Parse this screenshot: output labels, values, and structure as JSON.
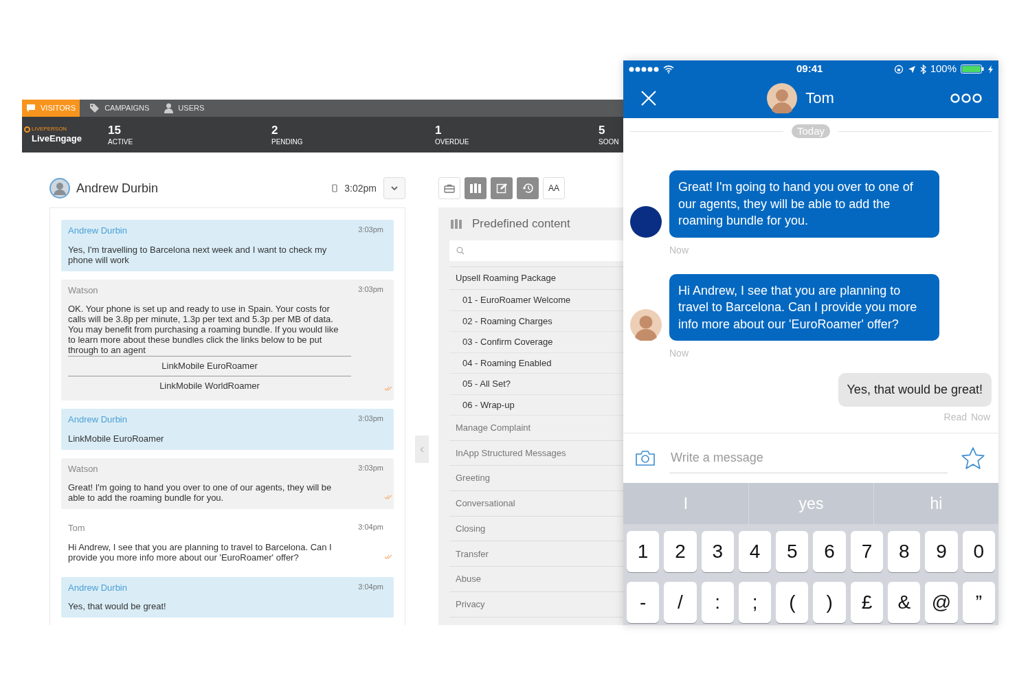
{
  "nav": {
    "tabs": [
      {
        "label": "VISITORS",
        "kind": "chat",
        "selected": true
      },
      {
        "label": "CAMPAIGNS",
        "kind": "tag",
        "selected": false
      },
      {
        "label": "USERS",
        "kind": "user",
        "selected": false
      }
    ]
  },
  "brand": {
    "tagline": "LIVEPERSON",
    "name": "LiveEngage"
  },
  "stats": [
    {
      "value": "15",
      "label": "ACTIVE"
    },
    {
      "value": "2",
      "label": "PENDING"
    },
    {
      "value": "1",
      "label": "OVERDUE"
    },
    {
      "value": "5",
      "label": "SOON"
    }
  ],
  "conversation": {
    "visitor": "Andrew Durbin",
    "time": "3:02pm",
    "messages": [
      {
        "kind": "visitor",
        "sender": "Andrew Durbin",
        "time": "3:03pm",
        "text": "Yes, I'm travelling to Barcelona next week and I want to check my phone will work",
        "read": false
      },
      {
        "kind": "bot",
        "sender": "Watson",
        "time": "3:03pm",
        "text": "OK. Your phone is set up and ready to use in Spain. Your costs for calls will be 3.8p per minute, 1.3p per text and 5.3p per MB of data. You may benefit from purchasing a roaming bundle. If you would like to learn more about these bundles click the links below to be put through to an agent",
        "links": [
          "LinkMobile EuroRoamer",
          "LinkMobile WorldRoamer"
        ],
        "read": true
      },
      {
        "kind": "visitor",
        "sender": "Andrew Durbin",
        "time": "3:03pm",
        "text": "LinkMobile EuroRoamer",
        "read": false
      },
      {
        "kind": "bot",
        "sender": "Watson",
        "time": "3:03pm",
        "text": "Great! I'm going to hand you over to one of our agents, they will be able to add the roaming bundle for you.",
        "read": true
      },
      {
        "kind": "agent",
        "sender": "Tom",
        "time": "3:04pm",
        "text": "Hi Andrew, I see that you are planning to travel to Barcelona. Can I provide you more info more about our 'EuroRoamer' offer?",
        "read": true
      },
      {
        "kind": "visitor",
        "sender": "Andrew Durbin",
        "time": "3:04pm",
        "text": "Yes, that would be great!",
        "read": false
      }
    ]
  },
  "tools": {
    "buttons": [
      {
        "kind": "briefcase",
        "selected": false
      },
      {
        "kind": "library",
        "selected": true
      },
      {
        "kind": "edit",
        "selected": true
      },
      {
        "kind": "history",
        "selected": true
      },
      {
        "kind": "text",
        "label": "AA",
        "selected": false
      }
    ]
  },
  "predefined": {
    "title": "Predefined content",
    "groups": [
      {
        "label": "Upsell Roaming Package",
        "expanded": true,
        "children": [
          {
            "label": "01 - EuroRoamer Welcome"
          },
          {
            "label": "02 - Roaming Charges"
          },
          {
            "label": "03 - Confirm Coverage"
          },
          {
            "label": "04 - Roaming Enabled"
          },
          {
            "label": "05 - All Set?"
          },
          {
            "label": "06 - Wrap-up"
          }
        ]
      },
      {
        "label": "Manage Complaint",
        "expanded": false
      },
      {
        "label": "InApp Structured Messages",
        "expanded": false
      },
      {
        "label": "Greeting",
        "expanded": false
      },
      {
        "label": "Conversational",
        "expanded": false
      },
      {
        "label": "Closing",
        "expanded": false
      },
      {
        "label": "Transfer",
        "expanded": false
      },
      {
        "label": "Abuse",
        "expanded": false
      },
      {
        "label": "Privacy",
        "expanded": false
      }
    ]
  },
  "phone": {
    "status_bar": {
      "time": "09:41",
      "battery": "100%"
    },
    "header": {
      "name": "Tom"
    },
    "divider": "Today",
    "messages": [
      {
        "kind": "bot",
        "text": "Great! I'm going to hand you over to one of our agents, they will be able to add the roaming bundle for you.",
        "time": "Now"
      },
      {
        "kind": "agent",
        "text": "Hi Andrew, I see that you are planning to travel to Barcelona. Can I provide you more info more about our 'EuroRoamer' offer?",
        "time": "Now"
      },
      {
        "kind": "visitor",
        "text": "Yes, that would be great!",
        "status": "Read",
        "time": "Now"
      }
    ],
    "input": {
      "placeholder": "Write a message"
    },
    "suggestions": [
      "I",
      "yes",
      "hi"
    ],
    "keyboard": [
      [
        "1",
        "2",
        "3",
        "4",
        "5",
        "6",
        "7",
        "8",
        "9",
        "0"
      ],
      [
        "-",
        "/",
        ":",
        ";",
        "(",
        ")",
        "£",
        "&",
        "@",
        "”"
      ]
    ]
  }
}
